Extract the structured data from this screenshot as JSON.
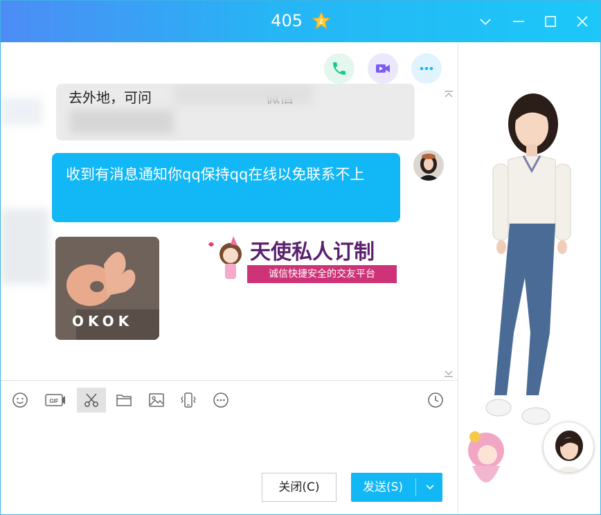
{
  "window": {
    "title": "405",
    "controls": [
      "chevron-down-icon",
      "minimize-icon",
      "maximize-icon",
      "close-icon"
    ]
  },
  "chat": {
    "top_actions": [
      {
        "name": "voice-call-icon",
        "color": "#1fc58e"
      },
      {
        "name": "video-call-icon",
        "color": "#7b5cf0"
      },
      {
        "name": "more-icon",
        "color": "#12b7f5"
      }
    ],
    "messages": [
      {
        "type": "incoming",
        "text": "去外地，可问                          微信"
      },
      {
        "type": "outgoing",
        "text": "收到有消息通知你qq保持qq在线以免联系不上"
      },
      {
        "type": "sticker",
        "text": "OKOK"
      }
    ],
    "ad": {
      "title": "天使私人订制",
      "subtitle": "诚信快捷安全的交友平台"
    }
  },
  "toolbar": {
    "items": [
      "emoji-icon",
      "gif-icon",
      "scissors-icon",
      "folder-icon",
      "image-icon",
      "shake-icon",
      "more-icon",
      "history-clock-icon"
    ],
    "gif_label": "GIF"
  },
  "buttons": {
    "close_label": "关闭(C)",
    "send_label": "发送(S)"
  },
  "colors": {
    "accent": "#12b7f5",
    "title_gradient_start": "#4d8cf5",
    "title_gradient_end": "#1cc8f8",
    "incoming_bubble": "#ebebeb"
  }
}
